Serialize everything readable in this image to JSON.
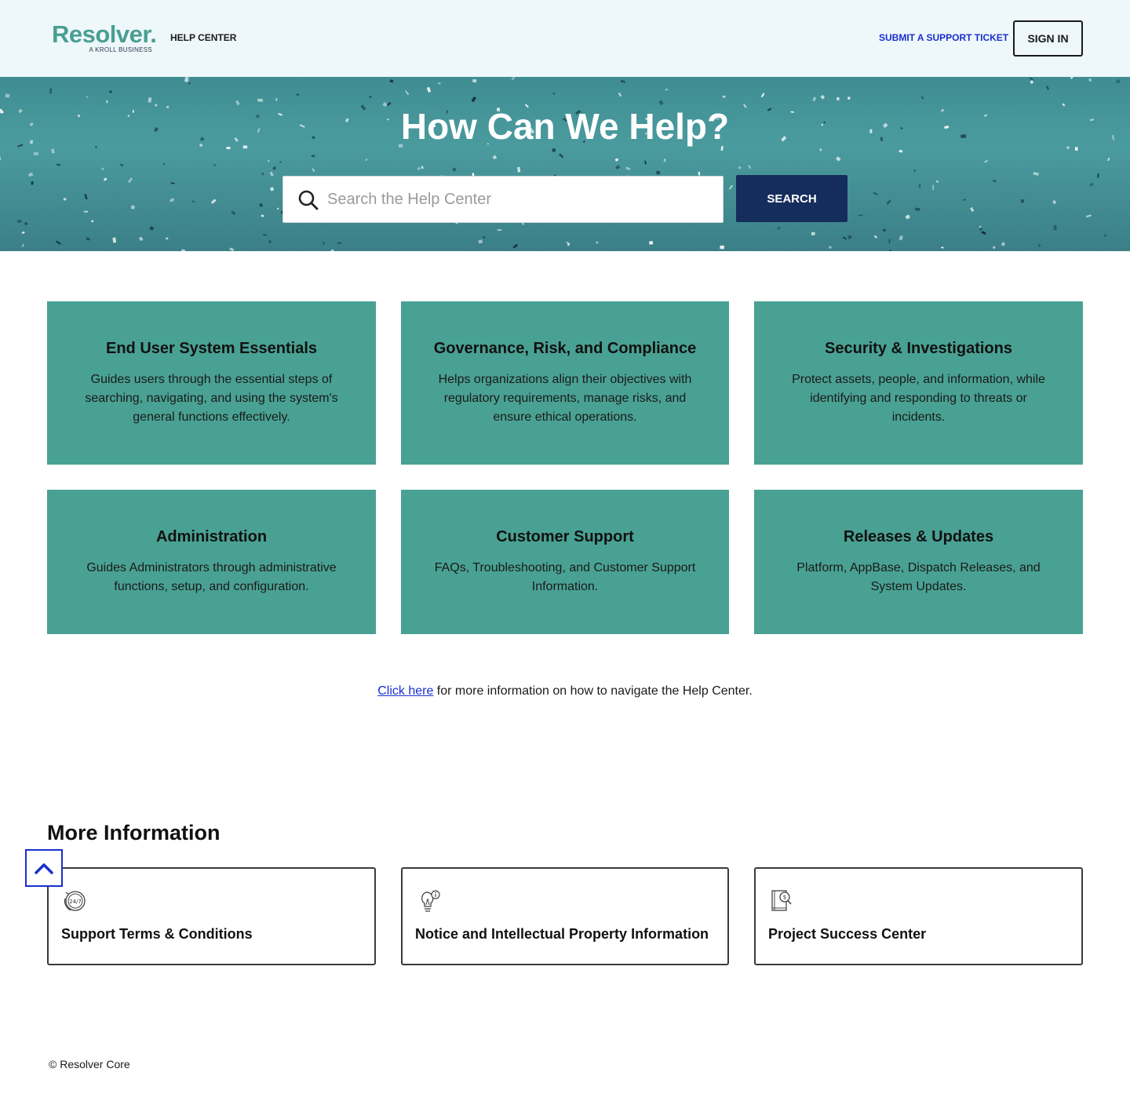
{
  "header": {
    "logo_text": "Resolver.",
    "logo_subtitle": "A KROLL BUSINESS",
    "help_center_label": "HELP CENTER",
    "submit_ticket_label": "SUBMIT A SUPPORT TICKET",
    "sign_in_label": "SIGN IN"
  },
  "hero": {
    "title": "How Can We Help?",
    "search_placeholder": "Search the Help Center",
    "search_button_label": "SEARCH"
  },
  "categories": [
    {
      "title": "End User System Essentials",
      "description": "Guides users through the essential steps of searching, navigating, and using the system's general functions effectively."
    },
    {
      "title": "Governance, Risk, and Compliance",
      "description": "Helps organizations align their objectives with regulatory requirements, manage risks, and ensure ethical operations."
    },
    {
      "title": "Security & Investigations",
      "description": "Protect assets, people, and information, while identifying and responding to threats or incidents."
    },
    {
      "title": "Administration",
      "description": "Guides Administrators through administrative functions, setup, and configuration."
    },
    {
      "title": "Customer Support",
      "description": "FAQs, Troubleshooting, and Customer Support Information."
    },
    {
      "title": "Releases & Updates",
      "description": "Platform, AppBase, Dispatch Releases, and System Updates."
    }
  ],
  "nav_note": {
    "link_text": "Click here",
    "rest_text": " for more information on how to navigate the Help Center."
  },
  "more_info": {
    "title": "More Information",
    "items": [
      {
        "label": "Support Terms & Conditions",
        "icon": "support-24-7-icon"
      },
      {
        "label": "Notice and Intellectual Property Information",
        "icon": "lightbulb-info-icon"
      },
      {
        "label": "Project Success Center",
        "icon": "book-search-icon"
      }
    ]
  },
  "back_to_top_icon": "chevron-up-icon",
  "footer": {
    "copyright": "© Resolver Core"
  },
  "colors": {
    "brand_teal": "#49a193",
    "header_bg": "#eef7fa",
    "search_button": "#152d5c",
    "link_blue": "#1a2fcc"
  }
}
